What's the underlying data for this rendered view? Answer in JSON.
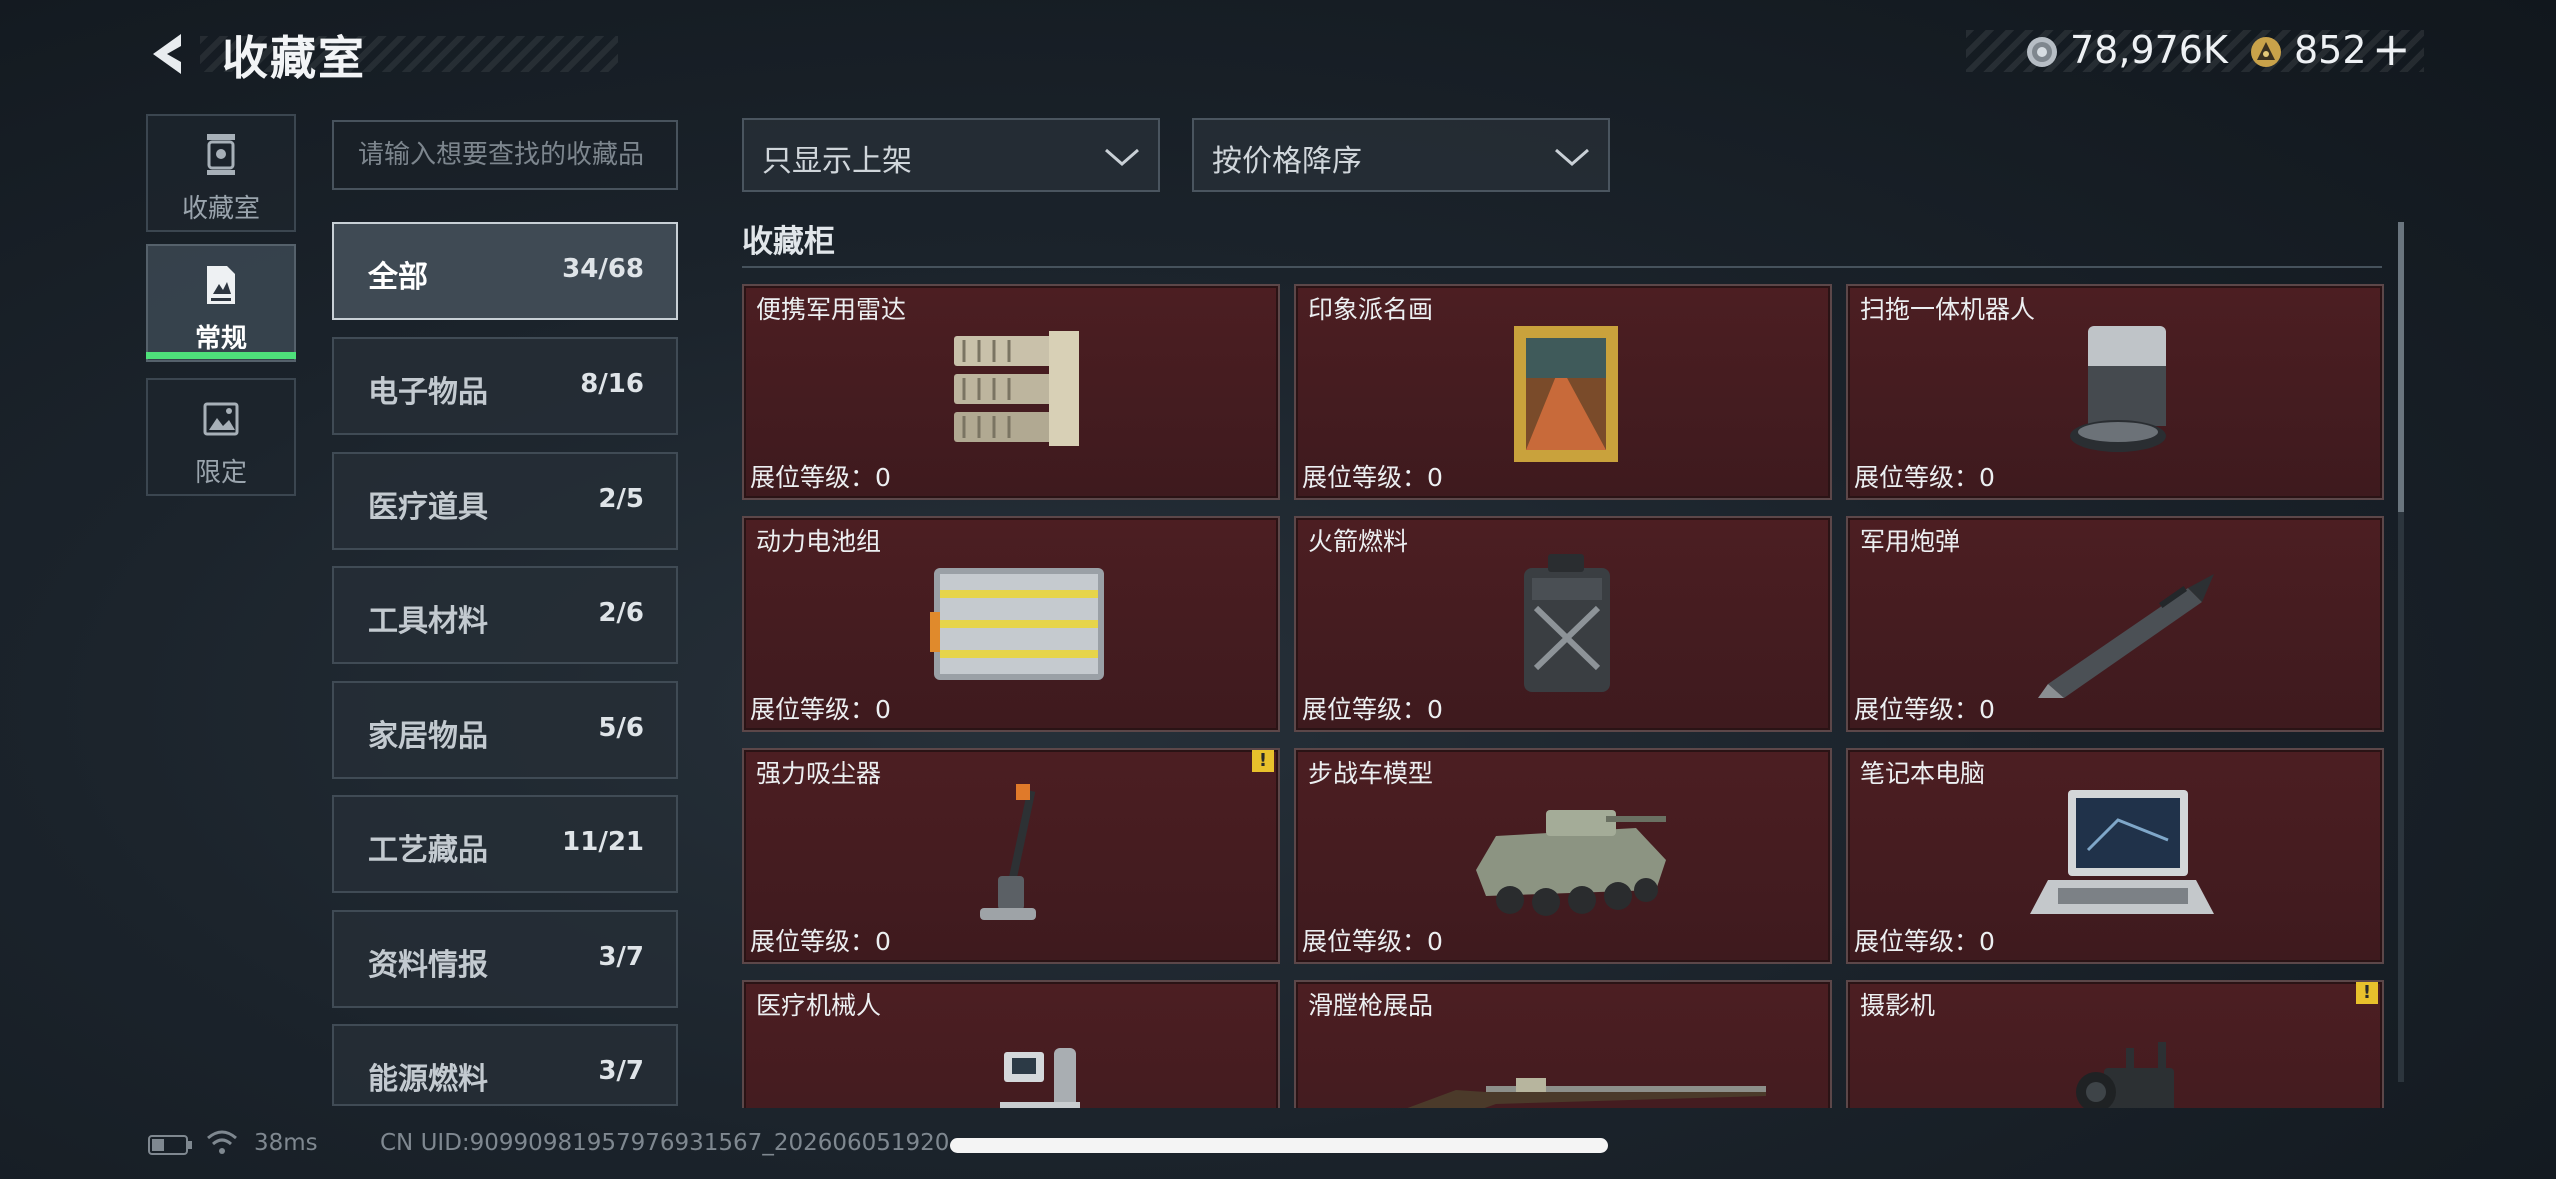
{
  "header": {
    "title": "收藏室",
    "currency_primary": "78,976K",
    "currency_secondary": "852",
    "add_symbol": "+"
  },
  "nav": {
    "items": [
      {
        "label": "收藏室",
        "icon": "trophy-icon"
      },
      {
        "label": "常规",
        "icon": "document-icon"
      },
      {
        "label": "限定",
        "icon": "landscape-icon"
      }
    ],
    "active_index": 1
  },
  "search": {
    "placeholder": "请输入想要查找的收藏品"
  },
  "categories": [
    {
      "name": "全部",
      "count": "34/68"
    },
    {
      "name": "电子物品",
      "count": "8/16"
    },
    {
      "name": "医疗道具",
      "count": "2/5"
    },
    {
      "name": "工具材料",
      "count": "2/6"
    },
    {
      "name": "家居物品",
      "count": "5/6"
    },
    {
      "name": "工艺藏品",
      "count": "11/21"
    },
    {
      "name": "资料情报",
      "count": "3/7"
    },
    {
      "name": "能源燃料",
      "count": "3/7"
    }
  ],
  "filters": {
    "display_filter": "只显示上架",
    "sort_order": "按价格降序"
  },
  "section": {
    "title": "收藏柜"
  },
  "items": [
    {
      "name": "便携军用雷达",
      "level": "展位等级：0",
      "warning": false
    },
    {
      "name": "印象派名画",
      "level": "展位等级：0",
      "warning": false
    },
    {
      "name": "扫拖一体机器人",
      "level": "展位等级：0",
      "warning": false
    },
    {
      "name": "动力电池组",
      "level": "展位等级：0",
      "warning": false
    },
    {
      "name": "火箭燃料",
      "level": "展位等级：0",
      "warning": false
    },
    {
      "name": "军用炮弹",
      "level": "展位等级：0",
      "warning": false
    },
    {
      "name": "强力吸尘器",
      "level": "展位等级：0",
      "warning": true
    },
    {
      "name": "步战车模型",
      "level": "展位等级：0",
      "warning": false
    },
    {
      "name": "笔记本电脑",
      "level": "展位等级：0",
      "warning": false
    },
    {
      "name": "医疗机械人",
      "level": "",
      "warning": false
    },
    {
      "name": "滑膛枪展品",
      "level": "",
      "warning": false
    },
    {
      "name": "摄影机",
      "level": "",
      "warning": true
    }
  ],
  "status": {
    "ping": "38ms",
    "uid": "CN UID:9099098195797693156​7_202606051920"
  },
  "colors": {
    "accent_green": "#4ee07a",
    "card_bg": "#4c1e22",
    "warning_yellow": "#e8c12c"
  }
}
